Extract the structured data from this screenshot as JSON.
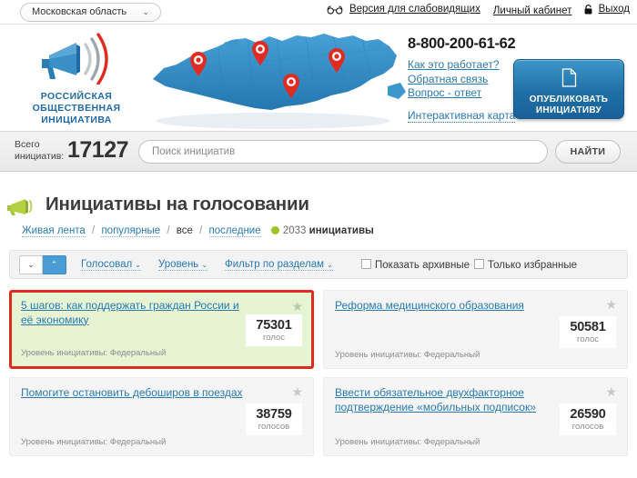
{
  "topbar": {
    "region": "Московская область",
    "region_chevron": "⌄",
    "accessibility_link": "Версия для слабовидящих",
    "account_link": "Личный кабинет",
    "logout_link": "Выход"
  },
  "hero": {
    "logo_line1": "РОССИЙСКАЯ",
    "logo_line2": "ОБЩЕСТВЕННАЯ",
    "logo_line3": "ИНИЦИАТИВА",
    "phone": "8-800-200-61-62",
    "links": [
      "Как это работает?",
      "Обратная связь",
      "Вопрос - ответ"
    ],
    "map_link": "Интерактивная карта",
    "publish_line1": "ОПУБЛИКОВАТЬ",
    "publish_line2": "ИНИЦИАТИВУ",
    "map_pins": 4
  },
  "search": {
    "total_label_line1": "Всего",
    "total_label_line2": "инициатив:",
    "total_count": "17127",
    "placeholder": "Поиск инициатив",
    "value": "",
    "find_button": "НАЙТИ"
  },
  "page": {
    "title": "Инициативы на голосовании",
    "subnav": {
      "live": "Живая лента",
      "popular": "популярные",
      "all": "все",
      "latest": "последние",
      "count": "2033",
      "count_label": "инициативы",
      "separator": "/"
    }
  },
  "toolbar": {
    "sort_down": "⌄",
    "sort_up": "⌃",
    "dropdowns": [
      {
        "label": "Голосовал",
        "caret": "⌄"
      },
      {
        "label": "Уровень",
        "caret": "⌄"
      },
      {
        "label": "Фильтр по разделам",
        "caret": "⌄"
      }
    ],
    "checkboxes": [
      {
        "label": "Показать архивные",
        "checked": false
      },
      {
        "label": "Только избранные",
        "checked": false
      }
    ]
  },
  "cards": [
    {
      "title": "5 шагов: как поддержать граждан России и её экономику",
      "votes": "75301",
      "votes_label": "голос",
      "level": "Уровень инициативы: Федеральный",
      "star": "★",
      "highlighted": true
    },
    {
      "title": "Реформа медицинского образования",
      "votes": "50581",
      "votes_label": "голос",
      "level": "Уровень инициативы: Федеральный",
      "star": "★",
      "highlighted": false
    },
    {
      "title": "Помогите остановить дебоширов в поездах",
      "votes": "38759",
      "votes_label": "голосов",
      "level": "Уровень инициативы: Федеральный",
      "star": "★",
      "highlighted": false
    },
    {
      "title": "Ввести обязательное двухфакторное подтверждение «мобильных подписок»",
      "votes": "26590",
      "votes_label": "голосов",
      "level": "Уровень инициативы: Федеральный",
      "star": "★",
      "highlighted": false
    }
  ],
  "colors": {
    "accent_blue": "#2a7ab0",
    "brand_blue": "#1f6aa5",
    "highlight_red": "#e02b20",
    "highlight_green_bg": "#e6f4d4",
    "dot_green": "#9ec521",
    "map_blue": "#2f89c8",
    "pin_red": "#e02b20"
  }
}
